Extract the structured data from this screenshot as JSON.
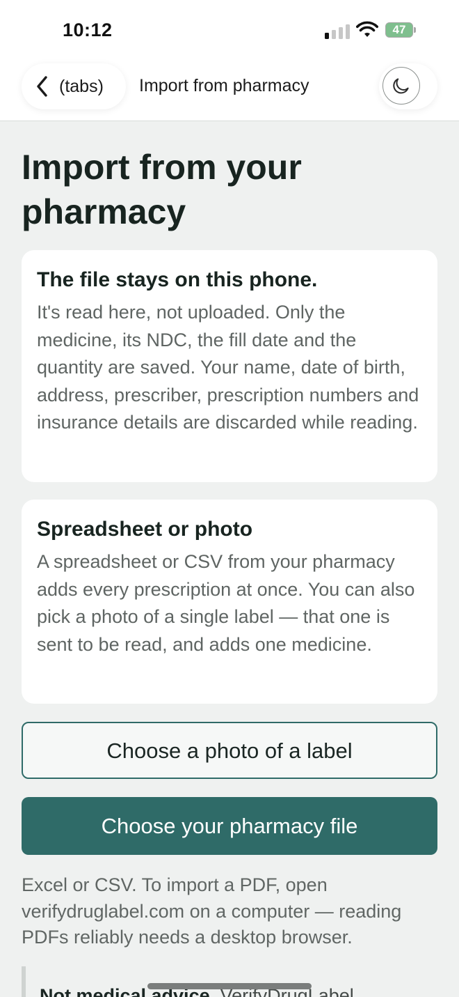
{
  "status_bar": {
    "time": "10:12",
    "battery_percent": "47",
    "signal_bars_active": 1,
    "signal_bars_total": 4
  },
  "nav": {
    "back_label": "(tabs)",
    "title": "Import from pharmacy",
    "theme_icon": "moon-icon"
  },
  "page": {
    "title": "Import from your pharmacy"
  },
  "cards": [
    {
      "heading": "The file stays on this phone.",
      "body": "It's read here, not uploaded. Only the medicine, its NDC, the fill date and the quantity are saved. Your name, date of birth, address, prescriber, prescription numbers and insurance details are discarded while reading."
    },
    {
      "heading": "Spreadsheet or photo",
      "body": "A spreadsheet or CSV from your pharmacy adds every prescription at once. You can also pick a photo of a single label — that one is sent to be read, and adds one medicine."
    }
  ],
  "actions": {
    "photo_button": "Choose a photo of a label",
    "file_button": "Choose your pharmacy file"
  },
  "hint": "Excel or CSV. To import a PDF, open verifydruglabel.com on a computer — reading PDFs reliably needs a desktop browser.",
  "disclaimer": {
    "lead": "Not medical advice.",
    "rest": "VerifyDrugLabel"
  },
  "colors": {
    "accent": "#2f6b68",
    "background": "#eff1f0",
    "card": "#ffffff",
    "battery": "#7fbf8e"
  }
}
